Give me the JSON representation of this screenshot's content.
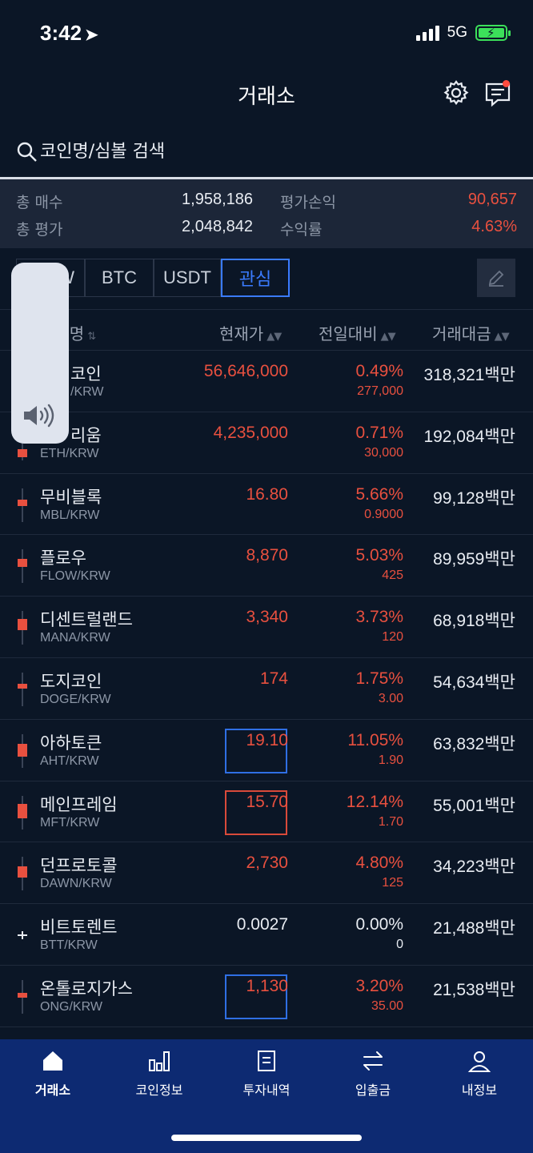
{
  "status_bar": {
    "time": "3:42",
    "network": "5G"
  },
  "header": {
    "title": "거래소",
    "settings_icon": "gear-icon",
    "chat_icon": "chat-icon"
  },
  "search": {
    "placeholder": "코인명/심볼 검색"
  },
  "summary": {
    "total_buy_label": "총 매수",
    "total_buy_value": "1,958,186",
    "total_eval_label": "총 평가",
    "total_eval_value": "2,048,842",
    "pnl_label": "평가손익",
    "pnl_value": "90,657",
    "return_label": "수익률",
    "return_value": "4.63%"
  },
  "tabs": [
    {
      "label": "W"
    },
    {
      "label": "BTC"
    },
    {
      "label": "USDT"
    },
    {
      "label": "관심"
    }
  ],
  "columns": {
    "name": "한글명",
    "price": "현재가",
    "change": "전일대비",
    "volume": "거래대금"
  },
  "coins": [
    {
      "name": "코인",
      "symbol": "/KRW",
      "price": "56,646,000",
      "change_pct": "0.49%",
      "change_amt": "277,000",
      "volume": "318,321백만"
    },
    {
      "name": "리움",
      "symbol": "ETH/KRW",
      "price": "4,235,000",
      "change_pct": "0.71%",
      "change_amt": "30,000",
      "volume": "192,084백만"
    },
    {
      "name": "무비블록",
      "symbol": "MBL/KRW",
      "price": "16.80",
      "change_pct": "5.66%",
      "change_amt": "0.9000",
      "volume": "99,128백만"
    },
    {
      "name": "플로우",
      "symbol": "FLOW/KRW",
      "price": "8,870",
      "change_pct": "5.03%",
      "change_amt": "425",
      "volume": "89,959백만"
    },
    {
      "name": "디센트럴랜드",
      "symbol": "MANA/KRW",
      "price": "3,340",
      "change_pct": "3.73%",
      "change_amt": "120",
      "volume": "68,918백만"
    },
    {
      "name": "도지코인",
      "symbol": "DOGE/KRW",
      "price": "174",
      "change_pct": "1.75%",
      "change_amt": "3.00",
      "volume": "54,634백만"
    },
    {
      "name": "아하토큰",
      "symbol": "AHT/KRW",
      "price": "19.10",
      "change_pct": "11.05%",
      "change_amt": "1.90",
      "volume": "63,832백만"
    },
    {
      "name": "메인프레임",
      "symbol": "MFT/KRW",
      "price": "15.70",
      "change_pct": "12.14%",
      "change_amt": "1.70",
      "volume": "55,001백만"
    },
    {
      "name": "던프로토콜",
      "symbol": "DAWN/KRW",
      "price": "2,730",
      "change_pct": "4.80%",
      "change_amt": "125",
      "volume": "34,223백만"
    },
    {
      "name": "비트토렌트",
      "symbol": "BTT/KRW",
      "price": "0.0027",
      "change_pct": "0.00%",
      "change_amt": "0",
      "volume": "21,488백만"
    },
    {
      "name": "온톨로지가스",
      "symbol": "ONG/KRW",
      "price": "1,130",
      "change_pct": "3.20%",
      "change_amt": "35.00",
      "volume": "21,538백만"
    }
  ],
  "nav": [
    {
      "label": "거래소",
      "icon": "home-icon"
    },
    {
      "label": "코인정보",
      "icon": "bar-chart-icon"
    },
    {
      "label": "투자내역",
      "icon": "document-icon"
    },
    {
      "label": "입출금",
      "icon": "transfer-icon"
    },
    {
      "label": "내정보",
      "icon": "person-icon"
    }
  ],
  "colors": {
    "background": "#0b1626",
    "rise": "#e8503f",
    "accent": "#3a7bff",
    "nav_bg": "#0d2a72"
  }
}
